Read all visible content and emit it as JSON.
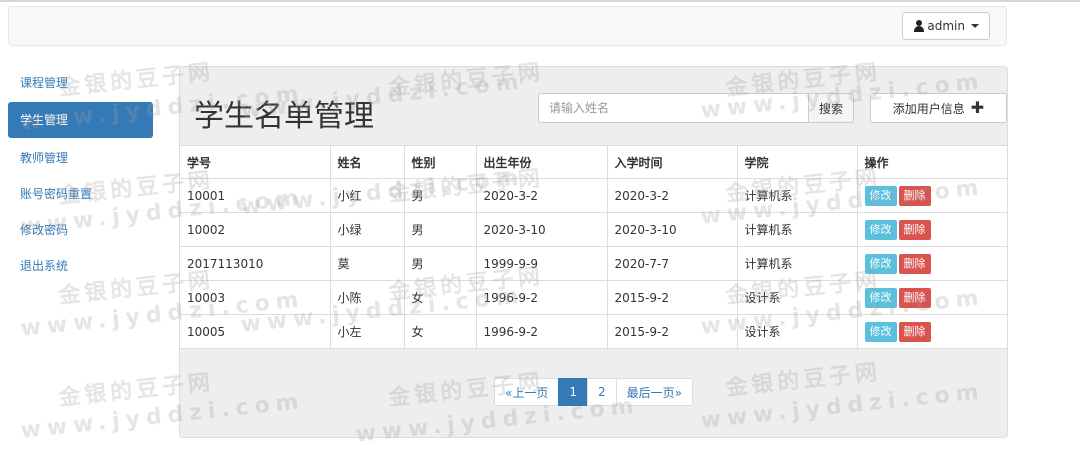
{
  "navbar": {
    "user_label": "admin"
  },
  "sidebar": {
    "items": [
      {
        "label": "课程管理"
      },
      {
        "label": "学生管理"
      },
      {
        "label": "教师管理"
      },
      {
        "label": "账号密码重置"
      },
      {
        "label": "修改密码"
      },
      {
        "label": "退出系统"
      }
    ]
  },
  "main": {
    "title": "学生名单管理",
    "search": {
      "placeholder": "请输入姓名",
      "button": "搜索"
    },
    "add_button": "添加用户信息"
  },
  "table": {
    "headers": [
      "学号",
      "姓名",
      "性别",
      "出生年份",
      "入学时间",
      "学院",
      "操作"
    ],
    "rows": [
      [
        "10001",
        "小红",
        "男",
        "2020-3-2",
        "2020-3-2",
        "计算机系"
      ],
      [
        "10002",
        "小绿",
        "男",
        "2020-3-10",
        "2020-3-10",
        "计算机系"
      ],
      [
        "2017113010",
        "莫",
        "男",
        "1999-9-9",
        "2020-7-7",
        "计算机系"
      ],
      [
        "10003",
        "小陈",
        "女",
        "1996-9-2",
        "2015-9-2",
        "设计系"
      ],
      [
        "10005",
        "小左",
        "女",
        "1996-9-2",
        "2015-9-2",
        "设计系"
      ]
    ],
    "edit_label": "修改",
    "delete_label": "删除"
  },
  "pagination": {
    "prev": "«上一页",
    "pages": [
      "1",
      "2"
    ],
    "last": "最后一页»",
    "current": "1"
  },
  "watermark": {
    "cn": "金银的豆子网",
    "en": "www.jyddzi.com"
  },
  "colors": {
    "primary": "#337ab7",
    "edit": "#5bc0de",
    "delete": "#d9534f",
    "panel": "#eeeeee"
  },
  "icons": {
    "user": "user-icon",
    "caret": "caret-down-icon",
    "plus": "plus-icon"
  }
}
